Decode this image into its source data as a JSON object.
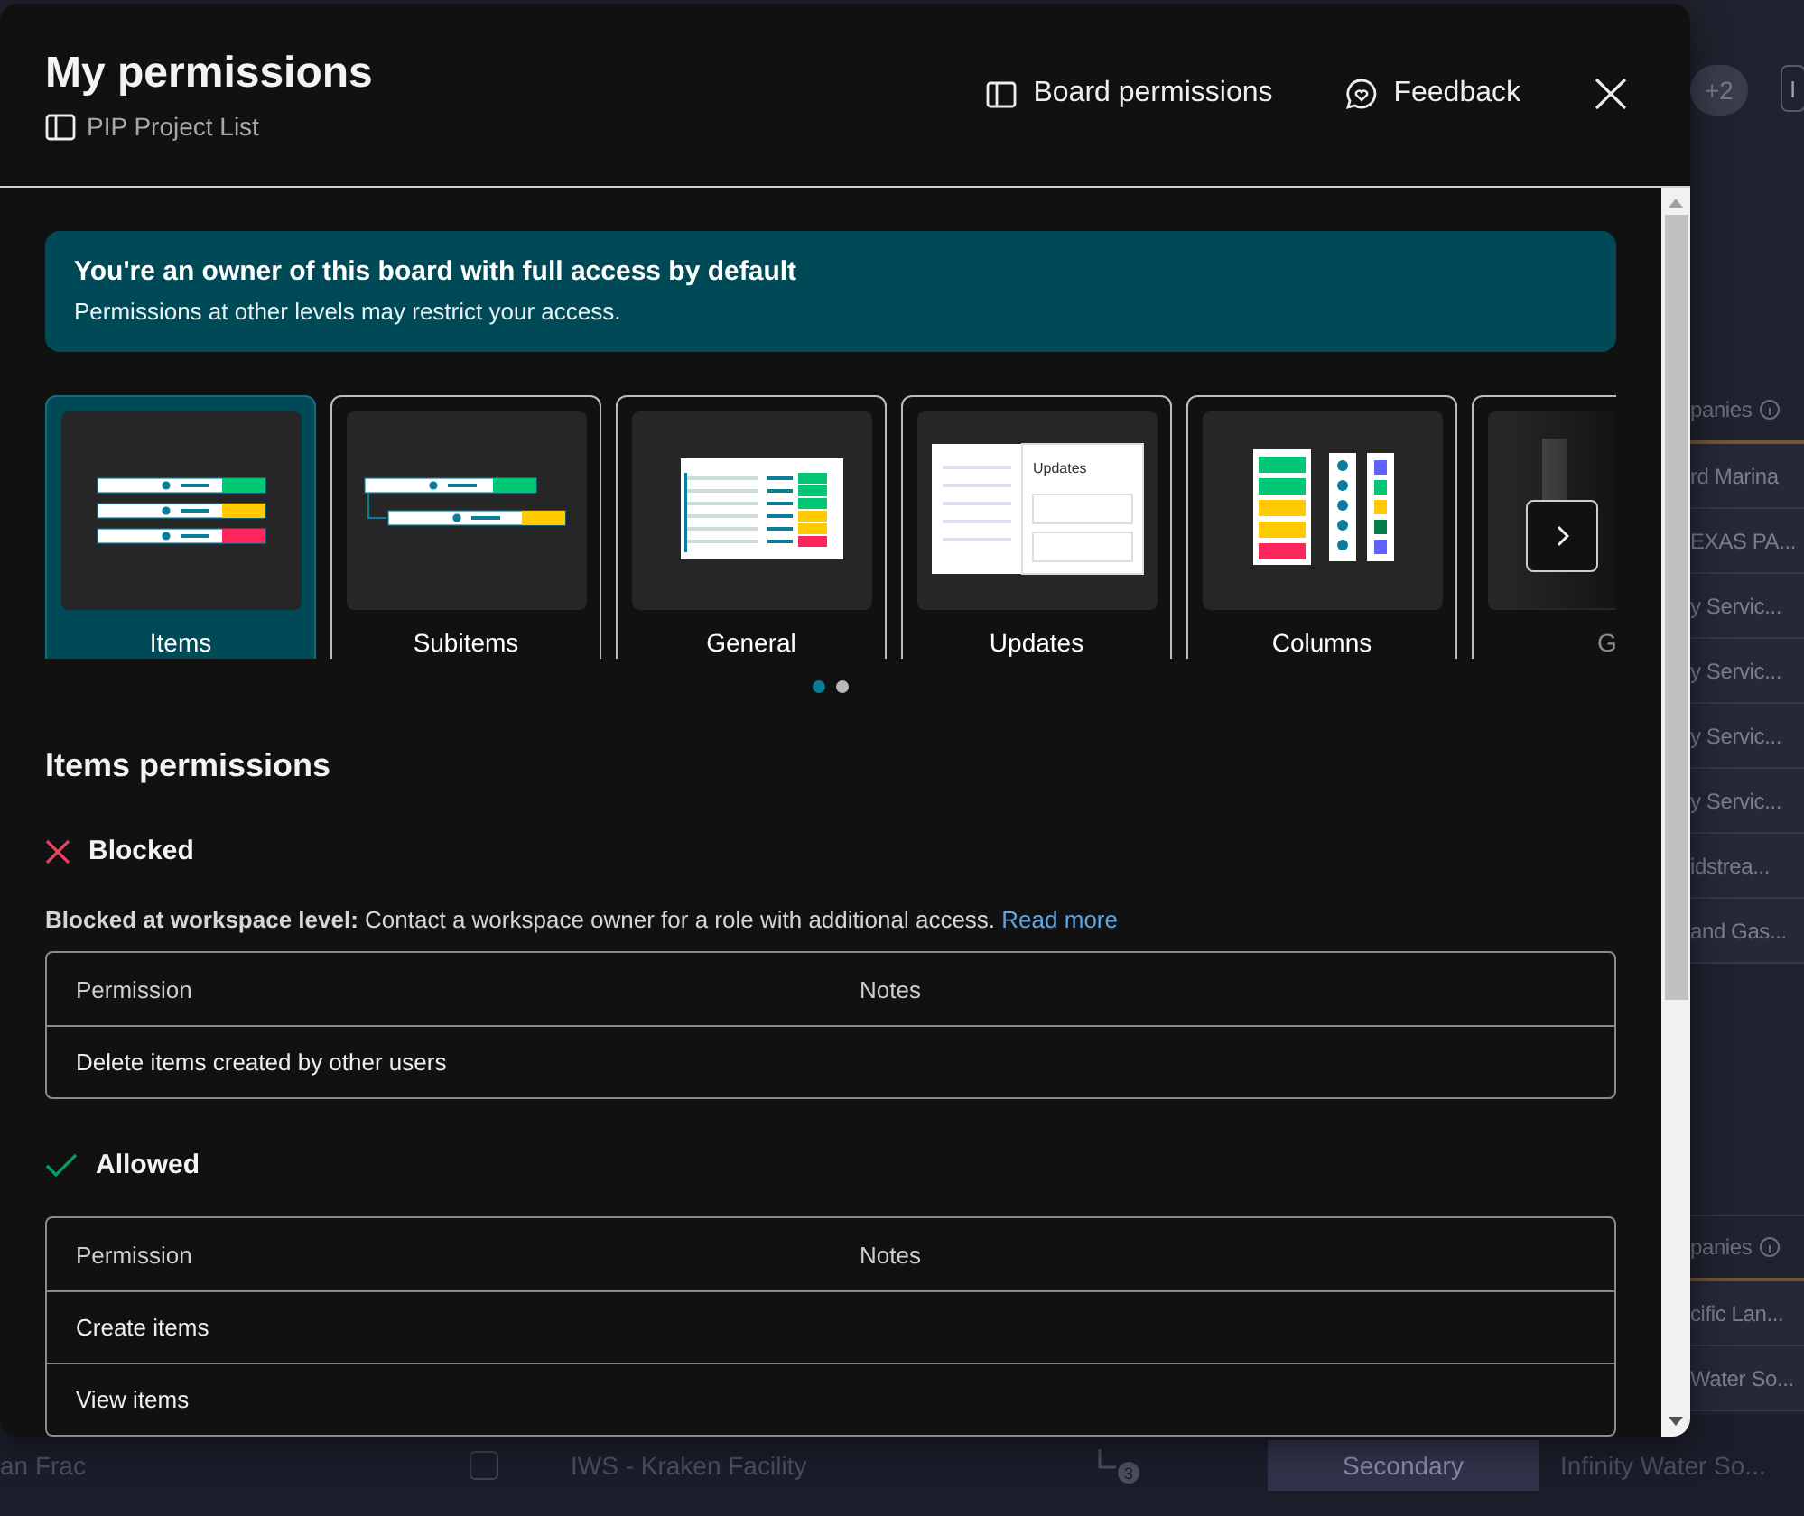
{
  "header": {
    "title": "My permissions",
    "board": "PIP Project List",
    "actions": [
      {
        "label": "Board permissions",
        "kind": "board"
      },
      {
        "label": "Feedback",
        "kind": "feedback"
      }
    ]
  },
  "banner": {
    "title": "You're an owner of this board with full access by default",
    "text": "Permissions at other levels may restrict your access."
  },
  "categories": [
    {
      "label": "Items",
      "kind": "items",
      "selected": true
    },
    {
      "label": "Subitems",
      "kind": "subitems",
      "selected": false
    },
    {
      "label": "General",
      "kind": "general",
      "selected": false
    },
    {
      "label": "Updates",
      "kind": "updates",
      "selected": false,
      "panel_title": "Updates"
    },
    {
      "label": "Columns",
      "kind": "columns",
      "selected": false
    },
    {
      "label": "G",
      "kind": "partial",
      "selected": false
    }
  ],
  "pagination": [
    {
      "selected": true
    },
    {
      "selected": false
    }
  ],
  "section_title": "Items permissions",
  "groups": [
    {
      "kind": "blocked",
      "label": "Blocked",
      "note": "**Blocked at workspace level:** Contact a workspace owner for a role with additional access.",
      "link": "Read more",
      "columns": [
        "Permission",
        "Notes"
      ],
      "rows": [
        {
          "permission": "Delete items created by other users"
        }
      ]
    },
    {
      "kind": "allowed",
      "label": "Allowed",
      "columns": [
        "Permission",
        "Notes"
      ],
      "rows": [
        {
          "permission": "Create items"
        },
        {
          "permission": "View items"
        }
      ]
    }
  ],
  "background": {
    "badge": "+2",
    "corner": "I",
    "column_items": [
      {
        "kind": "header",
        "text": "panies"
      },
      {
        "kind": "cell",
        "text": "rd Marina"
      },
      {
        "kind": "cell",
        "text": "EXAS PA..."
      },
      {
        "kind": "cell",
        "text": "y Servic..."
      },
      {
        "kind": "cell",
        "text": "y Servic..."
      },
      {
        "kind": "cell",
        "text": "y Servic..."
      },
      {
        "kind": "cell",
        "text": "y Servic..."
      },
      {
        "kind": "cell",
        "text": "idstrea..."
      },
      {
        "kind": "cell",
        "text": "and Gas..."
      },
      {
        "kind": "gap"
      },
      {
        "kind": "header",
        "text": "panies"
      },
      {
        "kind": "cell",
        "text": "cific Lan..."
      },
      {
        "kind": "cell",
        "text": "Water So..."
      }
    ],
    "bottom_row": {
      "checked": false,
      "left": "an Frac",
      "item": "IWS - Kraken Facility",
      "subitems": "3",
      "status": "Secondary",
      "company": "Infinity Water So..."
    }
  }
}
